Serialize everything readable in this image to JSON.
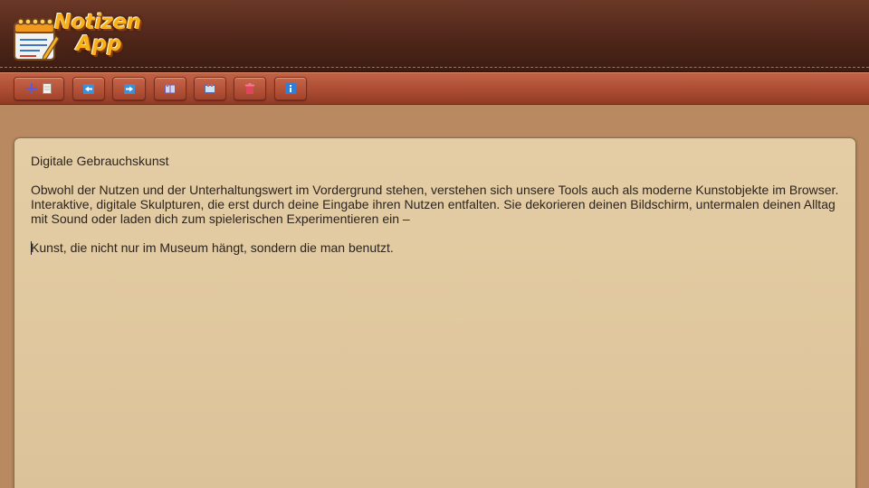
{
  "app": {
    "logo_line1": "Notizen",
    "logo_line2": "App"
  },
  "toolbar": {
    "buttons": [
      {
        "name": "new-note",
        "icons": [
          "plus-icon",
          "note-page-icon"
        ]
      },
      {
        "name": "back",
        "icons": [
          "arrow-left-icon"
        ]
      },
      {
        "name": "forward",
        "icons": [
          "arrow-right-icon"
        ]
      },
      {
        "name": "open-book",
        "icons": [
          "book-icon"
        ]
      },
      {
        "name": "screen",
        "icons": [
          "monitor-icon"
        ]
      },
      {
        "name": "delete",
        "icons": [
          "trash-icon"
        ]
      },
      {
        "name": "info",
        "icons": [
          "info-icon"
        ]
      }
    ]
  },
  "note": {
    "title": "Digitale Gebrauchskunst",
    "paragraph": "Obwohl der Nutzen und der Unterhaltungswert im Vordergrund stehen, verstehen sich unsere Tools auch als moderne Kunstobjekte im Browser. Interaktive, digitale Skulpturen, die erst durch deine Eingabe ihren Nutzen entfalten. Sie dekorieren deinen Bildschirm, untermalen deinen Alltag mit Sound oder laden dich zum spielerischen Experimentieren ein –",
    "closing": "Kunst, die nicht nur im Museum hängt, sondern die man benutzt."
  },
  "colors": {
    "header": "#4f2619",
    "toolbar": "#a94a31",
    "background": "#b98a61",
    "note": "#e0c8a0"
  }
}
